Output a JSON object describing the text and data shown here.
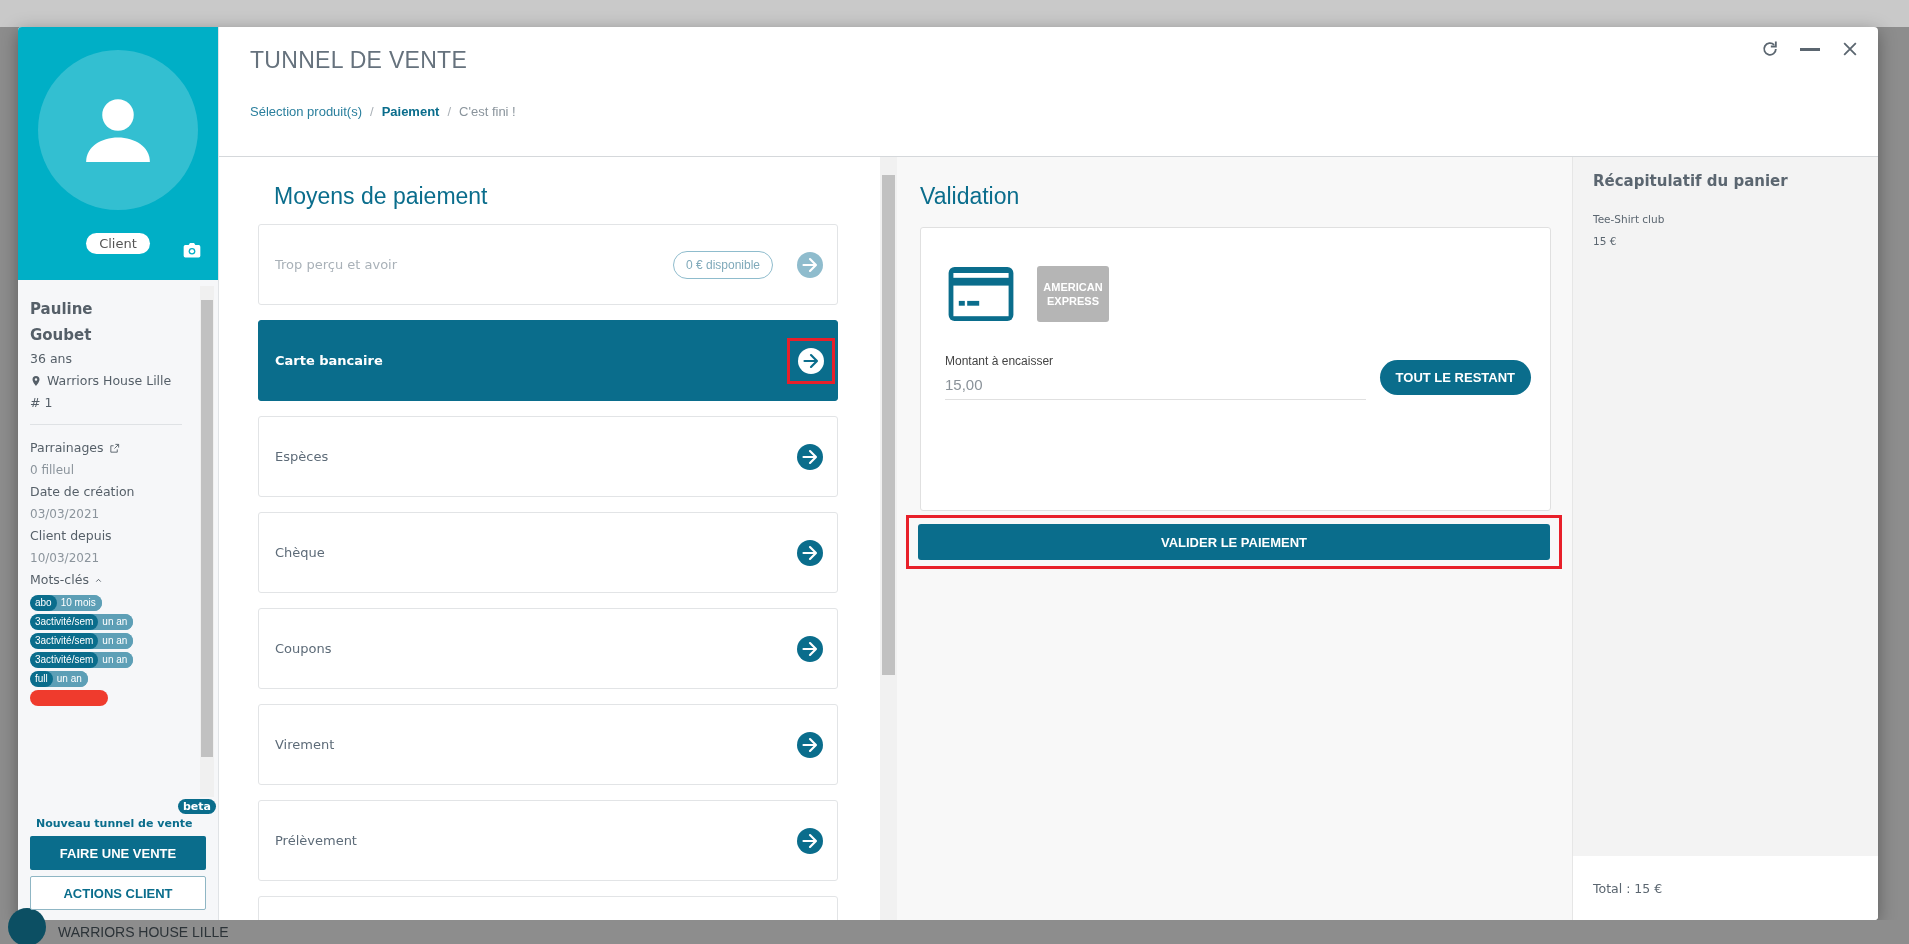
{
  "modal": {
    "title": "TUNNEL DE VENTE",
    "breadcrumb": [
      {
        "label": "Sélection produit(s)",
        "selected": false,
        "disabled": false
      },
      {
        "label": "Paiement",
        "selected": true,
        "disabled": false
      },
      {
        "label": "C'est fini !",
        "selected": false,
        "disabled": true
      }
    ],
    "separators": [
      "/",
      "/"
    ]
  },
  "client": {
    "badge": "Client",
    "first_name": "Pauline",
    "last_name": "Goubet",
    "age": "36 ans",
    "location": "Warriors House Lille",
    "number": "# 1",
    "fields": [
      {
        "kind": "link",
        "label": "Parrainages",
        "value": "0 filleul"
      },
      {
        "kind": "plain",
        "label": "Date de création",
        "value": "03/03/2021"
      },
      {
        "kind": "plain",
        "label": "Client depuis",
        "value": "10/03/2021"
      }
    ],
    "keywords": {
      "label": "Mots-clés",
      "expanded": true,
      "tags": [
        {
          "name": "abo",
          "duration": "10 mois",
          "color": "#0a6d8c"
        },
        {
          "name": "3activité/sem",
          "duration": "un an",
          "color": "#0a6d8c"
        },
        {
          "name": "3activité/sem",
          "duration": "un an",
          "color": "#0a6d8c"
        },
        {
          "name": "3activité/sem",
          "duration": "un an",
          "color": "#0a6d8c"
        },
        {
          "name": "full",
          "duration": "un an",
          "color": "#0a6d8c"
        },
        {
          "color": "#ef3b2d"
        }
      ]
    },
    "new_funnel_link": "Nouveau tunnel de vente",
    "beta_badge": "beta",
    "sale_button": "FAIRE UNE VENTE",
    "actions_button": "ACTIONS CLIENT"
  },
  "payment": {
    "title": "Moyens de paiement",
    "methods": [
      {
        "label": "Trop perçu et avoir",
        "badge": "0 € disponible",
        "disabled": true,
        "selected": false,
        "highlighted": false
      },
      {
        "label": "Carte bancaire",
        "disabled": false,
        "selected": true,
        "highlighted": true
      },
      {
        "label": "Espèces",
        "disabled": false,
        "selected": false,
        "highlighted": false
      },
      {
        "label": "Chèque",
        "disabled": false,
        "selected": false,
        "highlighted": false
      },
      {
        "label": "Coupons",
        "disabled": false,
        "selected": false,
        "highlighted": false
      },
      {
        "label": "Virement",
        "disabled": false,
        "selected": false,
        "highlighted": false
      },
      {
        "label": "Prélèvement",
        "disabled": false,
        "selected": false,
        "highlighted": false
      }
    ]
  },
  "validation": {
    "title": "Validation",
    "cards": [
      {
        "kind": "card",
        "selected": true
      },
      {
        "kind": "amex",
        "text": [
          "AMERICAN",
          "EXPRESS"
        ],
        "selected": false
      }
    ],
    "amount_label": "Montant à encaisser",
    "amount_value": "15,00",
    "remaining_button": "TOUT LE RESTANT",
    "validate_button": "VALIDER LE PAIEMENT",
    "validate_highlighted": true
  },
  "cart": {
    "title": "Récapitulatif du panier",
    "items": [
      {
        "name": "Tee-Shirt club",
        "price": "15 €"
      }
    ],
    "total": "Total : 15 €"
  },
  "background": {
    "footer_text": "WARRIORS HOUSE LILLE"
  }
}
